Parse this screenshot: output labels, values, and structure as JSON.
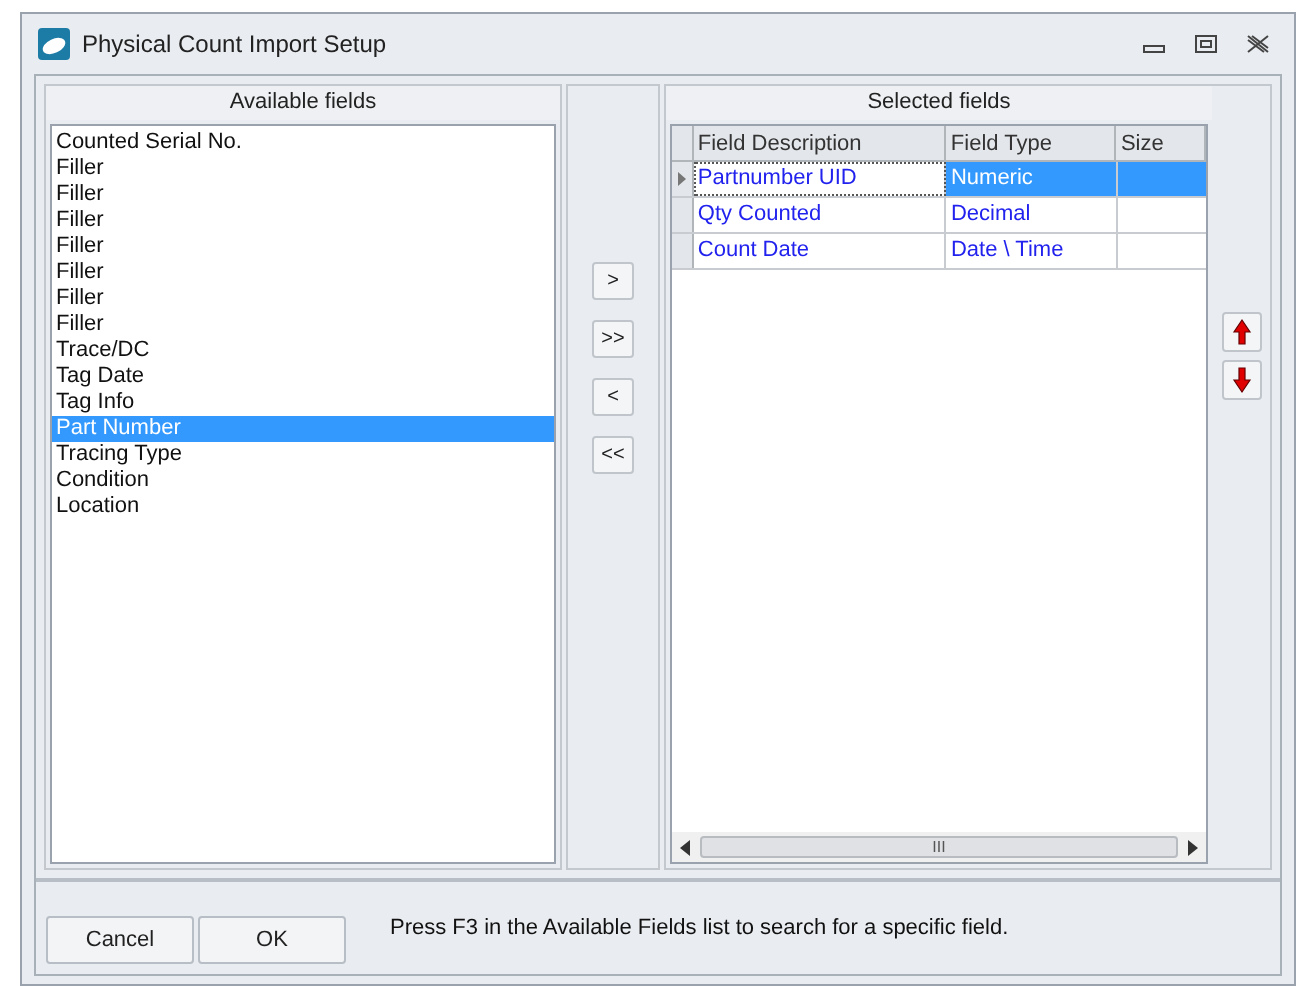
{
  "window": {
    "title": "Physical Count Import Setup"
  },
  "available_fields": {
    "header": "Available fields",
    "items": [
      {
        "label": "Counted Serial No.",
        "selected": false
      },
      {
        "label": "Filler",
        "selected": false
      },
      {
        "label": "Filler",
        "selected": false
      },
      {
        "label": "Filler",
        "selected": false
      },
      {
        "label": "Filler",
        "selected": false
      },
      {
        "label": "Filler",
        "selected": false
      },
      {
        "label": "Filler",
        "selected": false
      },
      {
        "label": "Filler",
        "selected": false
      },
      {
        "label": "Trace/DC",
        "selected": false
      },
      {
        "label": "Tag Date",
        "selected": false
      },
      {
        "label": "Tag Info",
        "selected": false
      },
      {
        "label": "Part Number",
        "selected": true
      },
      {
        "label": "Tracing Type",
        "selected": false
      },
      {
        "label": "Condition",
        "selected": false
      },
      {
        "label": "Location",
        "selected": false
      }
    ]
  },
  "transfer_buttons": [
    ">",
    ">>",
    "<",
    "<<"
  ],
  "selected_fields": {
    "header": "Selected fields",
    "columns": [
      "Field Description",
      "Field Type",
      "Size"
    ],
    "rows": [
      {
        "description": "Partnumber UID",
        "type": "Numeric",
        "selected": true
      },
      {
        "description": "Qty Counted",
        "type": "Decimal",
        "selected": false
      },
      {
        "description": "Count Date",
        "type": "Date \\ Time",
        "selected": false
      }
    ],
    "scrollbar_grip": "III"
  },
  "footer": {
    "buttons": [
      "Cancel",
      "OK"
    ],
    "hint": "Press F3 in the Available Fields list to search for a specific field."
  }
}
